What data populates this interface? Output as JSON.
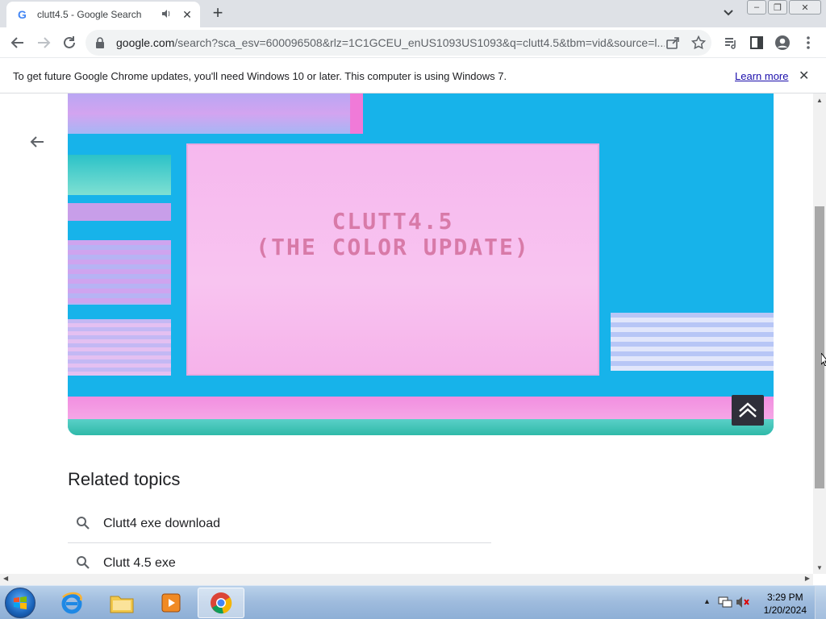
{
  "browser": {
    "tab": {
      "title": "clutt4.5 - Google Search"
    },
    "url": {
      "host": "google.com",
      "path": "/search?sca_esv=600096508&rlz=1C1GCEU_enUS1093US1093&q=clutt4.5&tbm=vid&source=l..."
    }
  },
  "infobar": {
    "message": "To get future Google Chrome updates, you'll need Windows 10 or later. This computer is using Windows 7.",
    "learn_more": "Learn more"
  },
  "video": {
    "title_line1": "CLUTT4.5",
    "title_line2": "(THE COLOR UPDATE)"
  },
  "related": {
    "heading": "Related topics",
    "items": [
      {
        "label": "Clutt4 exe download"
      },
      {
        "label": "Clutt 4.5 exe"
      }
    ]
  },
  "taskbar": {
    "clock_time": "3:29 PM",
    "clock_date": "1/20/2024"
  },
  "colors": {
    "video_bg": "#17b3ea",
    "screen_pink": "#f6b8ee",
    "link": "#1a0dab"
  }
}
